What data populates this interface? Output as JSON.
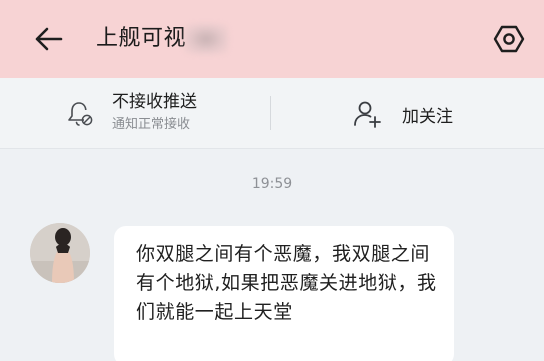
{
  "header": {
    "title": "上舰可视",
    "back_icon": "arrow-left-icon",
    "settings_icon": "hexagon-settings-icon",
    "background": "#f7d3d4"
  },
  "action_bar": {
    "notify": {
      "title": "不接收推送",
      "subtitle": "通知正常接收",
      "icon": "bell-off-icon"
    },
    "follow": {
      "label": "加关注",
      "icon": "user-plus-icon"
    }
  },
  "chat": {
    "timestamp": "19:59",
    "message": {
      "avatar": "avatar",
      "text": "你双腿之间有个恶魔，我双腿之间有个地狱,如果把恶魔关进地狱，我们就能一起上天堂"
    }
  }
}
